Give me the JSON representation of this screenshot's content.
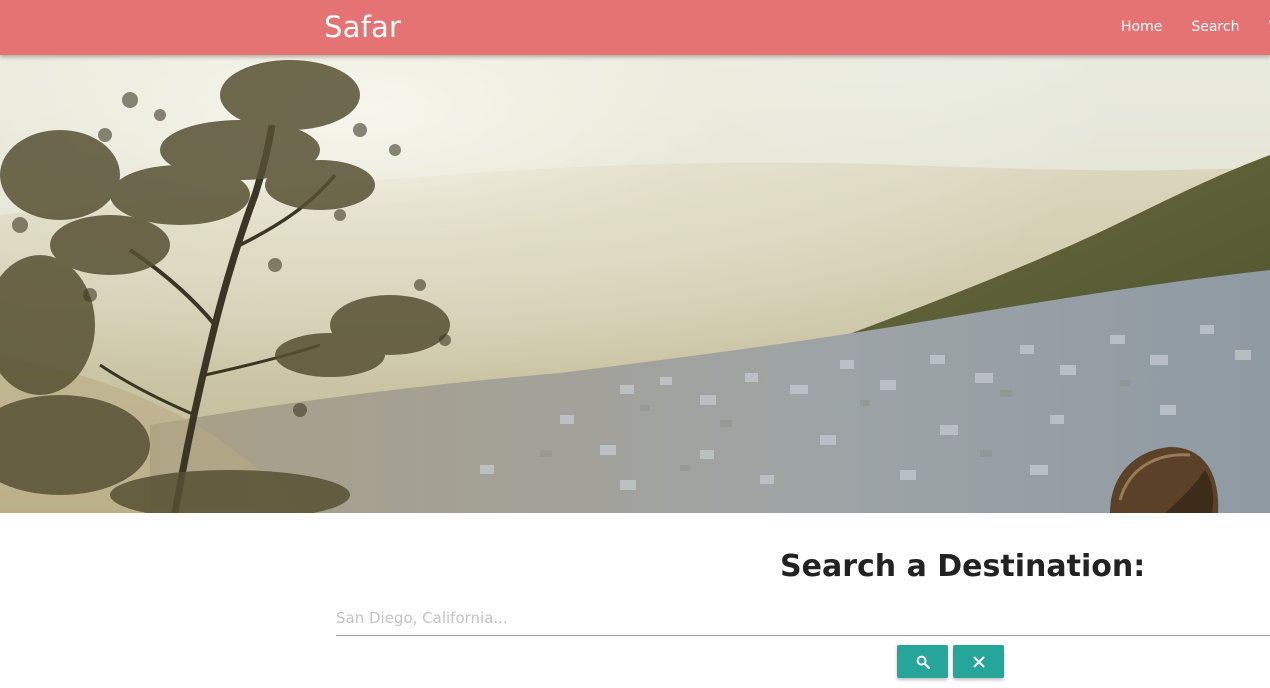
{
  "navbar": {
    "brand": "Safar",
    "links": [
      {
        "label": "Home"
      },
      {
        "label": "Search"
      },
      {
        "label": "W"
      }
    ],
    "color": "#e57373"
  },
  "search": {
    "title": "Search a Destination:",
    "placeholder": "San Diego, California...",
    "value": "",
    "search_button_icon": "search-icon",
    "clear_button_icon": "close-icon",
    "button_color": "#26a69a"
  }
}
